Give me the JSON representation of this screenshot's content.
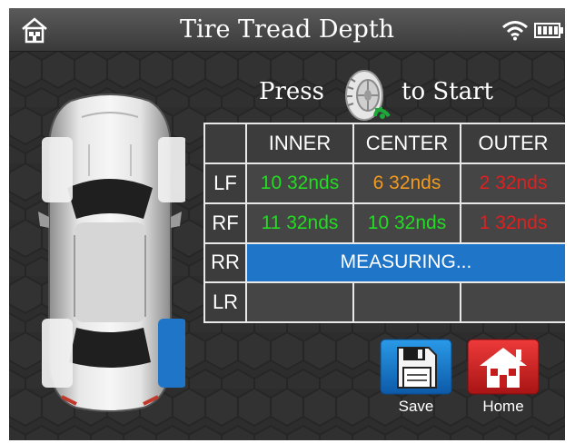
{
  "header": {
    "title": "Tire Tread Depth",
    "home_icon": "home-icon",
    "wifi_icon": "wifi-icon",
    "battery_icon": "battery-icon"
  },
  "prompt": {
    "press": "Press",
    "icon": "tire-scan-icon",
    "to_start": "to Start"
  },
  "table": {
    "columns": [
      "",
      "INNER",
      "CENTER",
      "OUTER"
    ],
    "rows": [
      {
        "label": "LF",
        "inner": "10 32nds",
        "center": "6 32nds",
        "outer": "2 32nds",
        "colors": [
          "green",
          "orange",
          "red"
        ]
      },
      {
        "label": "RF",
        "inner": "11 32nds",
        "center": "10 32nds",
        "outer": "1 32nds",
        "colors": [
          "green",
          "green",
          "red"
        ]
      },
      {
        "label": "RR",
        "status": "MEASURING..."
      },
      {
        "label": "LR",
        "inner": "",
        "center": "",
        "outer": ""
      }
    ]
  },
  "car": {
    "highlighted_tire": "rear-right",
    "highlight_color": "#1f75c8"
  },
  "buttons": {
    "save": {
      "label": "Save",
      "icon": "floppy-disk-icon"
    },
    "home": {
      "label": "Home",
      "icon": "house-icon"
    }
  },
  "colors": {
    "green": "#22dd22",
    "orange": "#f29a1d",
    "red": "#e02020",
    "accent_blue": "#1f75c8"
  }
}
